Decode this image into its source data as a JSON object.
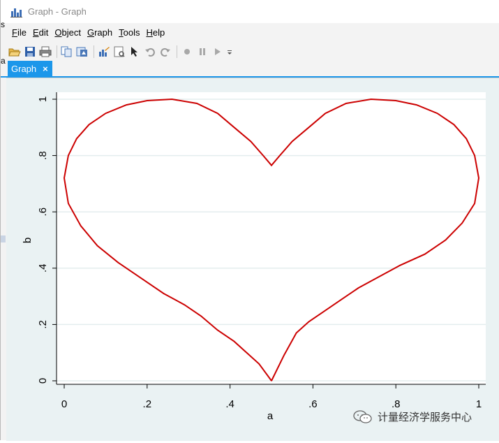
{
  "window": {
    "title": "Graph - Graph",
    "edge_text_top": "s",
    "edge_text_bottom": "a"
  },
  "menu": [
    {
      "label": "File",
      "mnemonic": "F",
      "rest": "ile"
    },
    {
      "label": "Edit",
      "mnemonic": "E",
      "rest": "dit"
    },
    {
      "label": "Object",
      "mnemonic": "O",
      "rest": "bject"
    },
    {
      "label": "Graph",
      "mnemonic": "G",
      "rest": "raph"
    },
    {
      "label": "Tools",
      "mnemonic": "T",
      "rest": "ools"
    },
    {
      "label": "Help",
      "mnemonic": "H",
      "rest": "elp"
    }
  ],
  "toolbar": {
    "icons": [
      "open-icon",
      "save-icon",
      "print-icon",
      "copy-icon",
      "rename-icon",
      "graph-editor-icon",
      "properties-icon",
      "select-icon",
      "undo-icon",
      "redo-icon",
      "record-icon",
      "pause-icon",
      "play-icon",
      "more-icon"
    ]
  },
  "tab": {
    "label": "Graph",
    "close_glyph": "×",
    "active_color": "#1c97ea"
  },
  "chart_data": {
    "type": "line",
    "title": "",
    "xlabel": "a",
    "ylabel": "b",
    "xlim": [
      0,
      1
    ],
    "ylim": [
      0,
      1
    ],
    "xticks": [
      0,
      0.2,
      0.4,
      0.6,
      0.8,
      1
    ],
    "xtick_labels": [
      "0",
      ".2",
      ".4",
      ".6",
      ".8",
      "1"
    ],
    "yticks": [
      0,
      0.2,
      0.4,
      0.6,
      0.8,
      1
    ],
    "ytick_labels": [
      "0",
      ".2",
      ".4",
      ".6",
      ".8",
      "1"
    ],
    "grid": true,
    "legend": "none",
    "line_color": "#cc0000",
    "series": [
      {
        "x": [
          0.5,
          0.47,
          0.44,
          0.41,
          0.37,
          0.33,
          0.29,
          0.24,
          0.19,
          0.13,
          0.08,
          0.04,
          0.01,
          0.0,
          0.01,
          0.03,
          0.06,
          0.1,
          0.15,
          0.2,
          0.26,
          0.32,
          0.37,
          0.41,
          0.45,
          0.48,
          0.5,
          0.52,
          0.55,
          0.59,
          0.63,
          0.68,
          0.74,
          0.8,
          0.85,
          0.9,
          0.94,
          0.97,
          0.99,
          1.0,
          0.99,
          0.96,
          0.92,
          0.87,
          0.81,
          0.76,
          0.71,
          0.67,
          0.63,
          0.59,
          0.56,
          0.53,
          0.5
        ],
        "y": [
          0.0,
          0.06,
          0.1,
          0.14,
          0.18,
          0.23,
          0.27,
          0.31,
          0.36,
          0.42,
          0.48,
          0.55,
          0.63,
          0.72,
          0.8,
          0.86,
          0.91,
          0.95,
          0.98,
          0.995,
          1.0,
          0.985,
          0.95,
          0.9,
          0.85,
          0.8,
          0.765,
          0.8,
          0.85,
          0.9,
          0.95,
          0.985,
          1.0,
          0.995,
          0.98,
          0.95,
          0.91,
          0.86,
          0.8,
          0.72,
          0.63,
          0.56,
          0.5,
          0.45,
          0.41,
          0.37,
          0.33,
          0.29,
          0.25,
          0.21,
          0.17,
          0.09,
          0.0
        ]
      }
    ]
  },
  "watermark": {
    "text": "计量经济学服务中心"
  }
}
